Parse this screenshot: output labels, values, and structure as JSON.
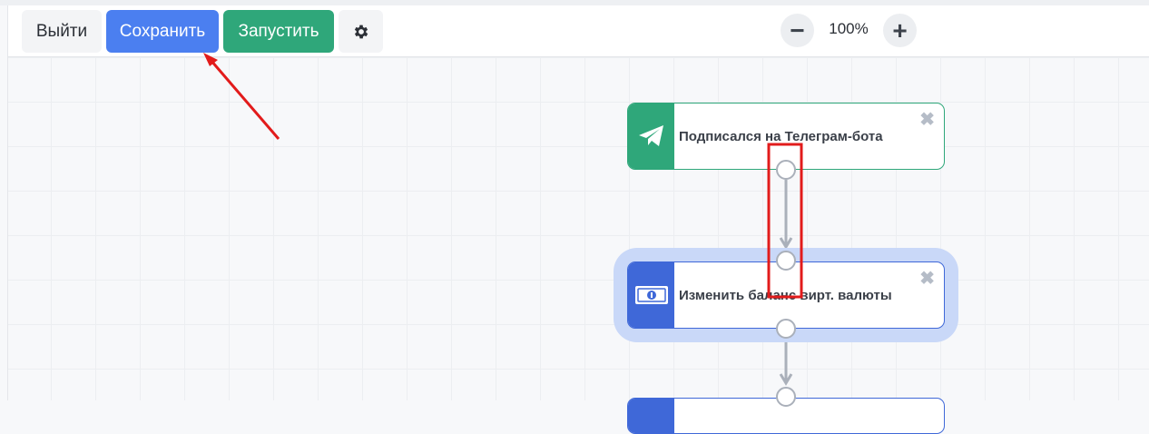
{
  "toolbar": {
    "exit_label": "Выйти",
    "save_label": "Сохранить",
    "run_label": "Запустить",
    "settings_icon": "gear-icon",
    "zoom_out_label": "−",
    "zoom_level": "100%",
    "zoom_in_label": "+"
  },
  "nodes": [
    {
      "title": "Подписался на Телеграм-бота",
      "icon": "telegram-icon",
      "close_label": "✖",
      "color": "#2fa77a"
    },
    {
      "title": "Изменить баланс вирт. валюты",
      "icon": "money-icon",
      "close_label": "✖",
      "color": "#3f68d8"
    },
    {
      "title": "",
      "icon": "",
      "close_label": "",
      "color": "#3f68d8"
    }
  ],
  "colors": {
    "accent_blue": "#4b7ff0",
    "accent_green": "#2fa77a",
    "annotation_red": "#e21b1b",
    "selection_halo": "#c9d8f8"
  }
}
